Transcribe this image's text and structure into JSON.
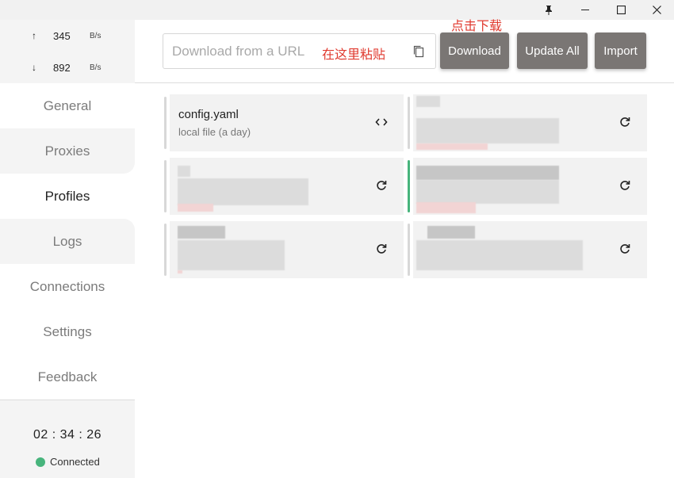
{
  "titlebar": {
    "pin": "pin-icon",
    "minimize": "minimize-icon",
    "maximize": "maximize-icon",
    "close": "close-icon"
  },
  "traffic": {
    "up_arrow": "↑",
    "up_value": "345",
    "up_unit": "B/s",
    "down_arrow": "↓",
    "down_value": "892",
    "down_unit": "B/s"
  },
  "nav": {
    "general": "General",
    "proxies": "Proxies",
    "profiles": "Profiles",
    "logs": "Logs",
    "connections": "Connections",
    "settings": "Settings",
    "feedback": "Feedback",
    "active": "Profiles"
  },
  "status": {
    "time": "02 : 34 : 26",
    "connection": "Connected",
    "connection_color": "#47b47c"
  },
  "toolbar": {
    "url_placeholder": "Download from a URL",
    "paste_annotation": "在这里粘贴",
    "download_annotation": "点击下载",
    "download_label": "Download",
    "update_all_label": "Update All",
    "import_label": "Import",
    "annotation_color": "#e03a2f"
  },
  "profiles": [
    {
      "name": "config.yaml",
      "sub": "local file (a day)",
      "icon": "code-icon",
      "selected": false
    },
    {
      "name": "",
      "sub": "",
      "icon": "refresh-icon",
      "selected": false
    },
    {
      "name": "",
      "sub": "",
      "icon": "refresh-icon",
      "selected": false
    },
    {
      "name": "",
      "sub": "",
      "icon": "refresh-icon",
      "selected": true
    },
    {
      "name": "",
      "sub": "",
      "icon": "refresh-icon",
      "selected": false
    },
    {
      "name": "",
      "sub": "",
      "icon": "refresh-icon",
      "selected": false
    }
  ]
}
